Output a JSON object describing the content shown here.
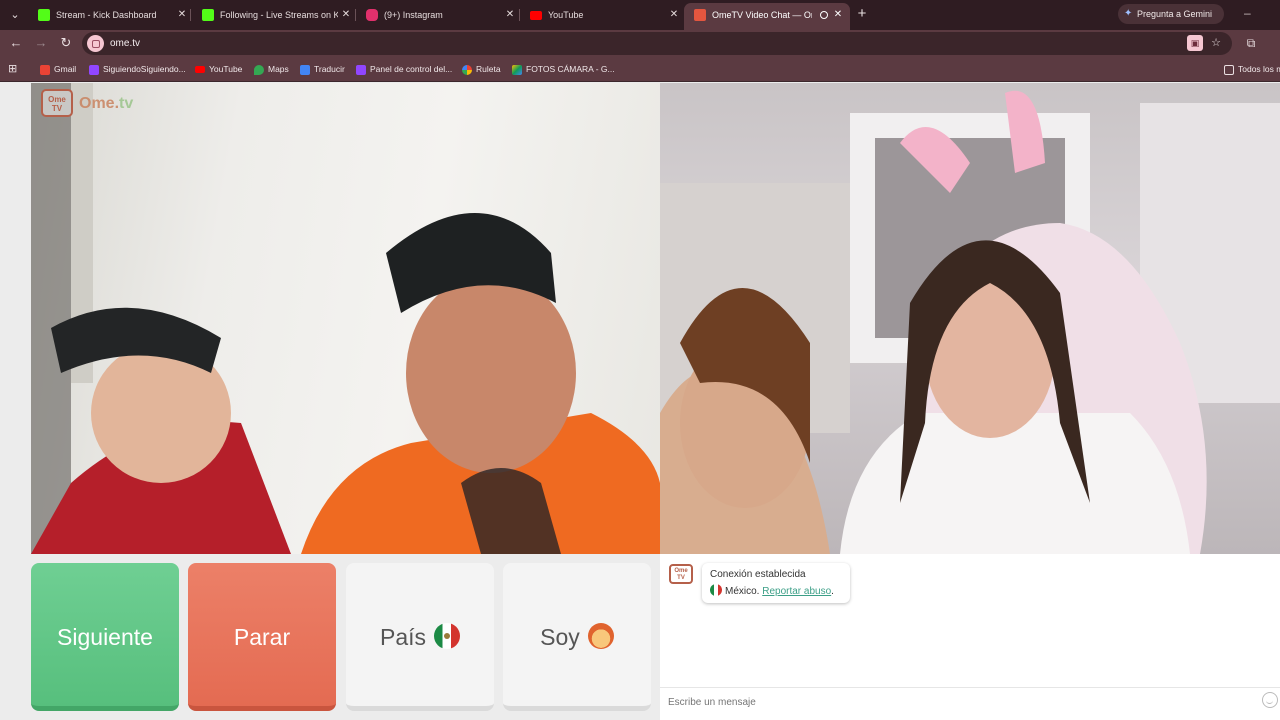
{
  "browser": {
    "tabs": [
      {
        "title": "Stream - Kick Dashboard",
        "favicon": "kick-icon",
        "color": "#53fc18"
      },
      {
        "title": "Following - Live Streams on Kick",
        "favicon": "kick-icon",
        "color": "#53fc18"
      },
      {
        "title": "(9+) Instagram",
        "favicon": "instagram-icon",
        "color": "#e1306c"
      },
      {
        "title": "YouTube",
        "favicon": "youtube-icon",
        "color": "#ff0000"
      },
      {
        "title": "OmeTV Video Chat — Omegle",
        "favicon": "ometv-icon",
        "color": "#e4563f",
        "active": true
      }
    ],
    "gemini_label": "Pregunta a Gemini",
    "url": "ome.tv",
    "bookmarks": [
      {
        "label": "Gmail",
        "color": "#ea4335"
      },
      {
        "label": "SiguiendoSiguiendo...",
        "color": "#9146ff"
      },
      {
        "label": "YouTube",
        "color": "#ff0000"
      },
      {
        "label": "Maps",
        "color": "#34a853"
      },
      {
        "label": "Traducir",
        "color": "#4285f4"
      },
      {
        "label": "Panel de control del...",
        "color": "#9146ff"
      },
      {
        "label": "Ruleta",
        "color": "#fbbc05"
      },
      {
        "label": "FOTOS CÁMARA - G...",
        "color": "#0f9d58"
      },
      {
        "label": "Todos los m",
        "color": "#eadfe1"
      }
    ]
  },
  "ometv": {
    "logo_badge": "Ome TV",
    "logo_text_main": "Ome.",
    "logo_text_tv": "tv",
    "buttons": {
      "next": "Siguiente",
      "stop": "Parar",
      "country": "País",
      "me": "Soy"
    },
    "chat": {
      "status": "Conexión establecida",
      "country": "México.",
      "report": "Reportar abuso",
      "placeholder": "Escribe un mensaje"
    }
  }
}
